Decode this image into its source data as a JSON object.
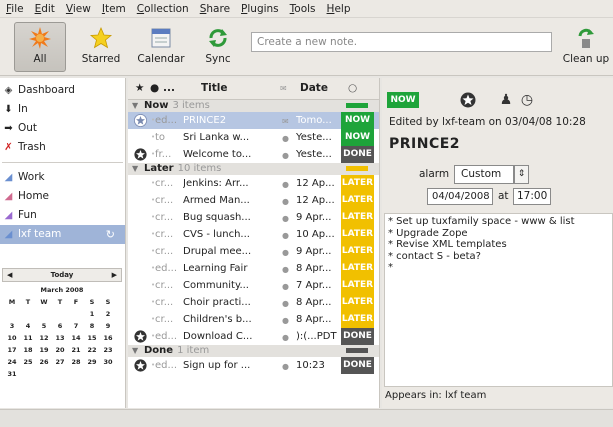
{
  "menu": [
    "File",
    "Edit",
    "View",
    "Item",
    "Collection",
    "Share",
    "Plugins",
    "Tools",
    "Help"
  ],
  "toolbar": {
    "all_label": "All",
    "starred_label": "Starred",
    "calendar_label": "Calendar",
    "sync_label": "Sync",
    "new_note_placeholder": "Create a new note.",
    "cleanup_label": "Clean up"
  },
  "sidebar": {
    "items": [
      {
        "label": "Dashboard",
        "icon": "dashboard-icon"
      },
      {
        "label": "In",
        "icon": "in-arrow-icon"
      },
      {
        "label": "Out",
        "icon": "out-arrow-icon"
      },
      {
        "label": "Trash",
        "icon": "trash-icon"
      }
    ],
    "collections": [
      {
        "label": "Work",
        "icon": "collection-icon",
        "color": "#6a8fd0"
      },
      {
        "label": "Home",
        "icon": "collection-icon",
        "color": "#d06a8f"
      },
      {
        "label": "Fun",
        "icon": "collection-icon",
        "color": "#9a6ad0"
      },
      {
        "label": "lxf team",
        "icon": "collection-icon",
        "color": "#6a8fd0",
        "selected": true
      }
    ]
  },
  "calendar": {
    "today_label": "Today",
    "month_label": "March 2008",
    "weekdays": [
      "M",
      "T",
      "W",
      "T",
      "F",
      "S",
      "S"
    ],
    "days": [
      "",
      "",
      "",
      "",
      "",
      "1",
      "2",
      "3",
      "4",
      "5",
      "6",
      "7",
      "8",
      "9",
      "10",
      "11",
      "12",
      "13",
      "14",
      "15",
      "16",
      "17",
      "18",
      "19",
      "20",
      "21",
      "22",
      "23",
      "24",
      "25",
      "26",
      "27",
      "28",
      "29",
      "30",
      "31"
    ]
  },
  "list": {
    "header": {
      "dots": "...",
      "title": "Title",
      "date": "Date"
    },
    "groups": [
      {
        "name": "Now",
        "count": "3 items",
        "bar_color": "#1ea43a",
        "rows": [
          {
            "icon": "star-icon",
            "src": "ed...",
            "title": "PRINCE2",
            "att": "mail-icon",
            "date": "Tomo...",
            "badge": "NOW",
            "badge_color": "#1ea43a",
            "selected": true
          },
          {
            "icon": "",
            "src": "to",
            "title": "Sri Lanka w...",
            "att": "",
            "date": "Yeste...",
            "badge": "NOW",
            "badge_color": "#1ea43a"
          },
          {
            "icon": "done-icon",
            "src": "fr...",
            "title": "Welcome to...",
            "att": "",
            "date": "Yeste...",
            "badge": "DONE",
            "badge_color": "#555555"
          }
        ]
      },
      {
        "name": "Later",
        "count": "10 items",
        "bar_color": "#f1c000",
        "rows": [
          {
            "icon": "",
            "src": "cr...",
            "title": "Jenkins: Arr...",
            "date": "12 Ap...",
            "badge": "LATER",
            "badge_color": "#f1c000"
          },
          {
            "icon": "",
            "src": "cr...",
            "title": "Armed Man...",
            "date": "12 Ap...",
            "badge": "LATER",
            "badge_color": "#f1c000"
          },
          {
            "icon": "",
            "src": "cr...",
            "title": "Bug squash...",
            "date": "9 Apr...",
            "badge": "LATER",
            "badge_color": "#f1c000"
          },
          {
            "icon": "",
            "src": "cr...",
            "title": "CVS - lunch...",
            "date": "10 Ap...",
            "badge": "LATER",
            "badge_color": "#f1c000"
          },
          {
            "icon": "",
            "src": "cr...",
            "title": "Drupal mee...",
            "date": "9 Apr...",
            "badge": "LATER",
            "badge_color": "#f1c000"
          },
          {
            "icon": "",
            "src": "ed...",
            "title": "Learning Fair",
            "date": "8 Apr...",
            "badge": "LATER",
            "badge_color": "#f1c000"
          },
          {
            "icon": "",
            "src": "cr...",
            "title": "Community...",
            "date": "7 Apr...",
            "badge": "LATER",
            "badge_color": "#f1c000"
          },
          {
            "icon": "",
            "src": "cr...",
            "title": "Choir practi...",
            "date": "8 Apr...",
            "badge": "LATER",
            "badge_color": "#f1c000"
          },
          {
            "icon": "",
            "src": "cr...",
            "title": "Children's b...",
            "date": "8 Apr...",
            "badge": "LATER",
            "badge_color": "#f1c000"
          },
          {
            "icon": "done-icon",
            "src": "ed...",
            "title": "Download C...",
            "date": "):(...PDT",
            "badge": "DONE",
            "badge_color": "#555555"
          }
        ]
      },
      {
        "name": "Done",
        "count": "1 item",
        "bar_color": "#555555",
        "rows": [
          {
            "icon": "done-icon",
            "src": "ed...",
            "title": "Sign up for ...",
            "date": "10:23",
            "badge": "DONE",
            "badge_color": "#555555"
          }
        ]
      }
    ]
  },
  "detail": {
    "triage_badge": "NOW",
    "edited_by": "Edited by lxf-team on 03/04/08 10:28",
    "title": "PRINCE2",
    "alarm_label": "alarm",
    "alarm_value": "Custom",
    "alarm_date": "04/04/2008",
    "at_label": "at",
    "alarm_time": "17:00",
    "body_lines": [
      "* Set up tuxfamily space - www & list",
      "* Upgrade Zope",
      "* Revise XML templates",
      "* contact S - beta?",
      "*"
    ],
    "appears_in": "Appears in: lxf team"
  }
}
